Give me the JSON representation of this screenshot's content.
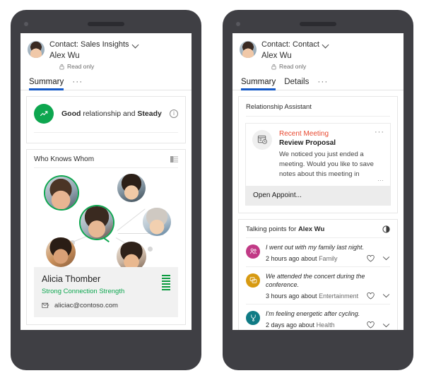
{
  "phones": {
    "left": {
      "header": {
        "avatar": "contact-avatar",
        "title": "Contact: Sales Insights",
        "chevron": "chevron-down-icon",
        "name": "Alex Wu",
        "lock": "lock-icon",
        "meta": "Read only"
      },
      "tabs": [
        {
          "label": "Summary",
          "active": true
        }
      ],
      "tabs_overflow": "···",
      "relationship": {
        "icon": "trending-up-icon",
        "prefix": "Good",
        "middle": " relationship and ",
        "suffix": "Steady",
        "info": "i",
        "color": "#0da64f"
      },
      "who_knows_whom": {
        "title": "Who Knows Whom",
        "list_icon": "grid-list-icon",
        "nodes": [
          {
            "name": "node-alicia",
            "highlight": true
          },
          {
            "name": "node-center-alex",
            "highlight": true
          },
          {
            "name": "node-contact-2",
            "highlight": false
          },
          {
            "name": "node-contact-3",
            "highlight": false
          },
          {
            "name": "node-contact-4",
            "highlight": false
          },
          {
            "name": "node-contact-5",
            "highlight": false
          }
        ]
      },
      "contact_detail": {
        "name": "Alicia Thomber",
        "strength": "Strong Connection Strength",
        "mail_icon": "email-icon",
        "email": "aliciac@contoso.com",
        "strength_bars": 6,
        "strength_color": "#0a9b3f"
      }
    },
    "right": {
      "header": {
        "avatar": "contact-avatar",
        "title": "Contact: Contact",
        "chevron": "chevron-down-icon",
        "name": "Alex Wu",
        "lock": "lock-icon",
        "meta": "Read only"
      },
      "tabs": [
        {
          "label": "Summary",
          "active": true
        },
        {
          "label": "Details",
          "active": false
        }
      ],
      "tabs_overflow": "···",
      "relationship_assistant": {
        "title": "Relationship Assistant",
        "card": {
          "icon": "calendar-clock-icon",
          "category": "Recent Meeting",
          "category_color": "#e8482f",
          "subject": "Review Proposal",
          "description": "We noticed you just ended a meeting. Would you like to save notes about this meeting in",
          "overflow": "···",
          "truncation": "…",
          "action": "Open Appoint..."
        }
      },
      "talking_points": {
        "title_prefix": "Talking points for ",
        "title_name": "Alex Wu",
        "visibility_icon": "eye-icon",
        "items": [
          {
            "icon": "family-icon",
            "color": "#c13a86",
            "quote": "I went out with my family last night.",
            "time": "2 hours ago about ",
            "topic": "Family",
            "like_icon": "heart-icon",
            "expand_icon": "chevron-down-icon"
          },
          {
            "icon": "entertainment-icon",
            "color": "#d79a12",
            "quote": "We attended the concert during the conference.",
            "time": "3 hours ago about ",
            "topic": "Entertainment",
            "like_icon": "heart-icon",
            "expand_icon": "chevron-down-icon"
          },
          {
            "icon": "health-icon",
            "color": "#0f7b85",
            "quote": "I'm feeling energetic after cycling.",
            "time": "2 days ago about ",
            "topic": "Health",
            "like_icon": "heart-icon",
            "expand_icon": "chevron-down-icon"
          }
        ]
      }
    }
  },
  "theme": {
    "accent": "#1559c7",
    "frame": "#3f3f44",
    "green": "#0da64f",
    "red": "#e8482f"
  }
}
